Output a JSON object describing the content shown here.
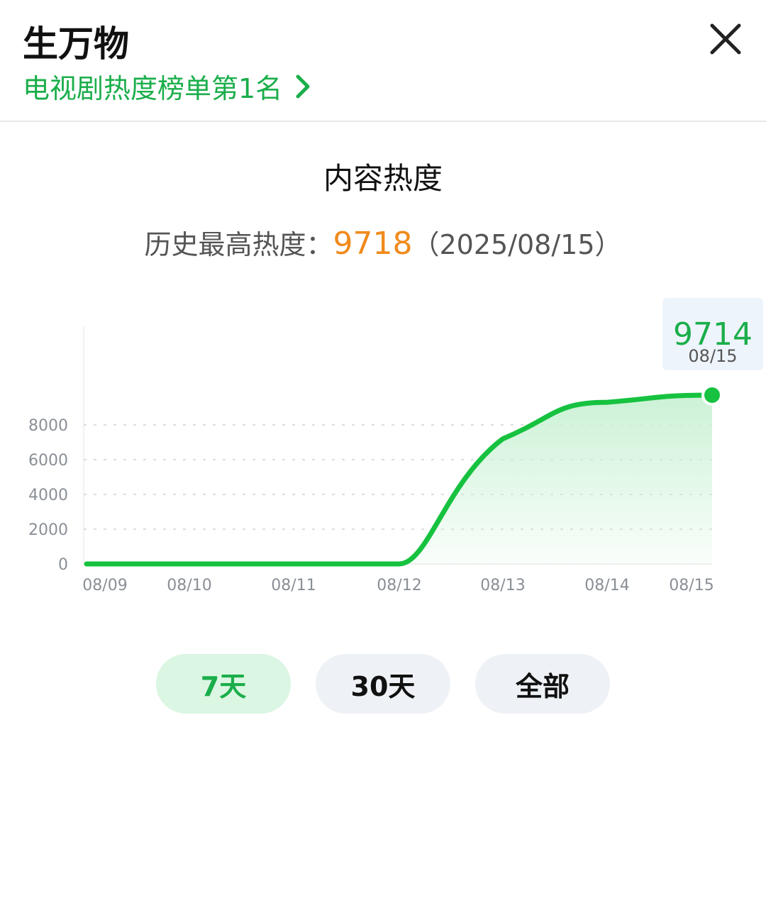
{
  "header": {
    "title": "生万物",
    "rank_text": "电视剧热度榜单第1名"
  },
  "section": {
    "title": "内容热度",
    "history_label": "历史最高热度：",
    "history_value": "9718",
    "history_date": "（2025/08/15）"
  },
  "chart_data": {
    "type": "area",
    "x": [
      "08/09",
      "08/10",
      "08/11",
      "08/12",
      "08/13",
      "08/14",
      "08/15"
    ],
    "values": [
      0,
      0,
      0,
      0,
      7200,
      9300,
      9714
    ],
    "ylim": [
      0,
      10000
    ],
    "yticks": [
      0,
      2000,
      4000,
      6000,
      8000
    ],
    "grid": true,
    "line_color": "#16c23f",
    "fill_color": "#c9f1d4",
    "tooltip": {
      "value": "9714",
      "date": "08/15"
    }
  },
  "buttons": [
    {
      "label": "7天",
      "active": true
    },
    {
      "label": "30天",
      "active": false
    },
    {
      "label": "全部",
      "active": false
    }
  ],
  "colors": {
    "accent": "#1aae4a",
    "highlight": "#f08a1c"
  }
}
